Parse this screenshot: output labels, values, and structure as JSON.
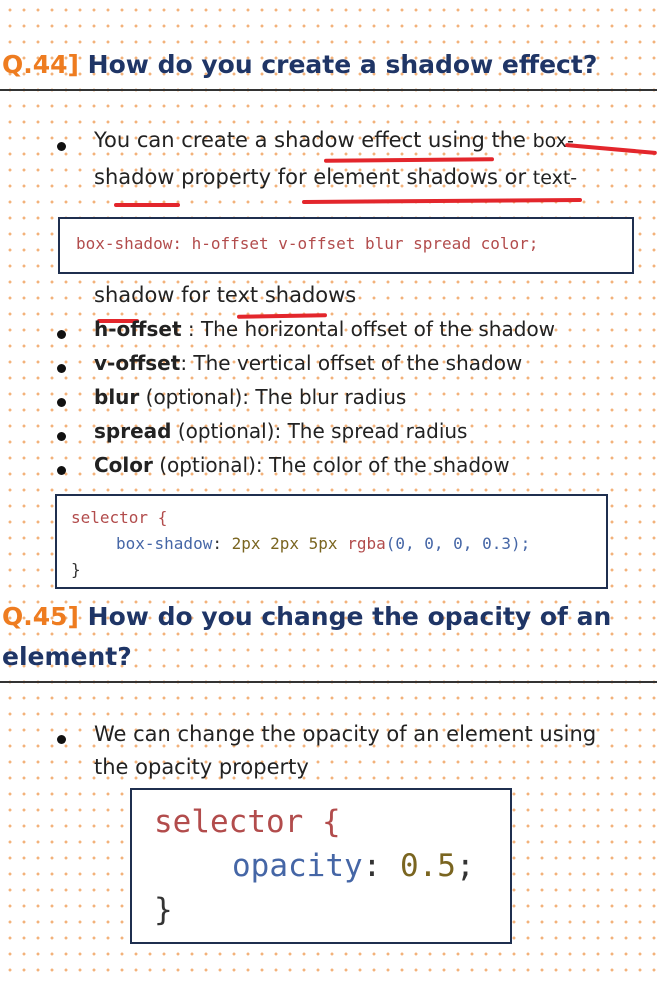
{
  "q44": {
    "number": "Q.44]",
    "title": " How do you create a shadow effect?",
    "intro_line1_a": "You can create a shadow effect using the ",
    "intro_line1_b": "box-",
    "intro_line2_a": "shadow property for element shadows or ",
    "intro_line2_b": "text-",
    "code1": "box-shadow: h-offset v-offset blur spread color;",
    "intro_line3": "shadow for text shadows",
    "bullets": [
      {
        "term": "h-offset",
        "desc": " : The horizontal offset of the shadow"
      },
      {
        "term": "v-offset",
        "desc": ": The vertical offset of the shadow"
      },
      {
        "term": "blur",
        "desc": " (optional): The blur radius"
      },
      {
        "term": "spread",
        "desc": " (optional): The spread radius"
      },
      {
        "term": "Color",
        "desc": " (optional): The color of the shadow"
      }
    ],
    "code2": {
      "selector": "selector {",
      "prop": "box-shadow",
      "colon": ": ",
      "values": "2px 2px 5px",
      "fn": "rgba",
      "args": "(0, 0, 0, 0.3);",
      "close": "}"
    }
  },
  "q45": {
    "number": "Q.45]",
    "title_line1": " How do you change the opacity of an",
    "title_line2": "element?",
    "text_line1": "We can change the opacity of an element using",
    "text_line2": "the opacity property",
    "code": {
      "selector": "selector {",
      "prop": "opacity",
      "colon": ": ",
      "value": "0.5",
      "semi": ";",
      "close": "}"
    }
  },
  "colors": {
    "accent": "#ee7c20",
    "title": "#1f3566",
    "highlight_underline": "#e3262c",
    "code_border": "#1f2f4f"
  }
}
